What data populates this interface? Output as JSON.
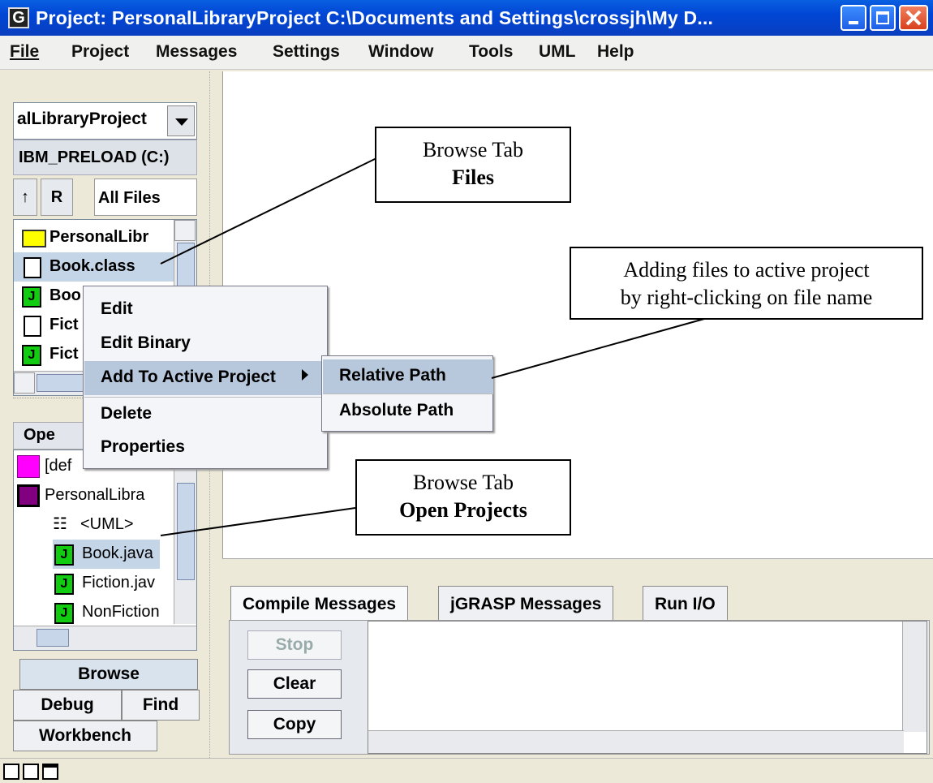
{
  "window": {
    "title": "Project: PersonalLibraryProject  C:\\Documents and Settings\\crossjh\\My D...",
    "app_icon": "G"
  },
  "menu": [
    "File",
    "Project",
    "Messages",
    "Settings",
    "Window",
    "Tools",
    "UML",
    "Help"
  ],
  "browse": {
    "project_combo": "alLibraryProject",
    "drive": "IBM_PRELOAD (C:)",
    "up_label": "↑",
    "refresh_label": "R",
    "filter": "All Files",
    "files": [
      "PersonalLibr",
      "Book.class",
      "Boo",
      "Fict",
      "Fict"
    ]
  },
  "open_projects": {
    "header": "Ope",
    "items": [
      "[def",
      "PersonalLibra",
      "<UML>",
      "Book.java",
      "Fiction.jav",
      "NonFiction"
    ]
  },
  "bottom_tabs": [
    "Browse",
    "Debug",
    "Find",
    "Workbench"
  ],
  "context_menu": {
    "items": [
      "Edit",
      "Edit Binary",
      "Add To Active Project",
      "Delete",
      "Properties"
    ],
    "submenu": [
      "Relative Path",
      "Absolute Path"
    ]
  },
  "messages": {
    "tabs": [
      "Compile Messages",
      "jGRASP Messages",
      "Run I/O"
    ],
    "buttons": [
      "Stop",
      "Clear",
      "Copy"
    ]
  },
  "callouts": {
    "files_line1": "Browse Tab",
    "files_line2": "Files",
    "adding_line1": "Adding files to active project",
    "adding_line2": "by right-clicking on file name",
    "open_line1": "Browse Tab",
    "open_line2": "Open Projects"
  }
}
